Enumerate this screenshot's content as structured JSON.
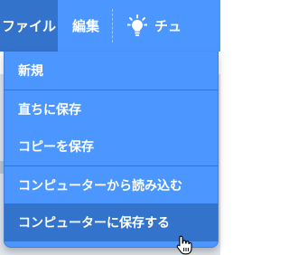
{
  "menubar": {
    "file_label": "ファイル",
    "edit_label": "編集",
    "tutorial_label": "チュ",
    "tutorial_icon": "lightbulb-icon"
  },
  "file_menu": {
    "items": [
      {
        "label": "新規"
      },
      {
        "label": "直ちに保存"
      },
      {
        "label": "コピーを保存"
      },
      {
        "label": "コンピューターから読み込む"
      },
      {
        "label": "コンピューターに保存する"
      }
    ]
  },
  "colors": {
    "menubar": "#4c97ff",
    "active_tab": "#3373cc",
    "menu_item_hover": "#3373cc",
    "text": "#ffffff"
  }
}
